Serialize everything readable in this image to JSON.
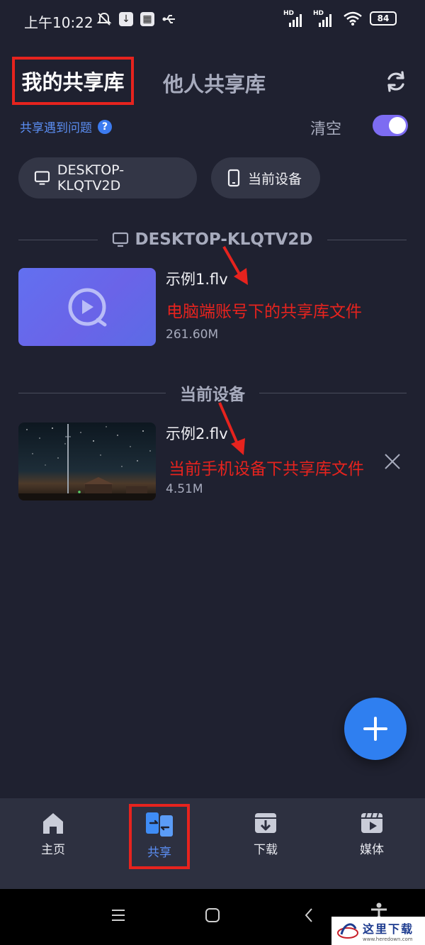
{
  "status_bar": {
    "time": "上午10:22",
    "battery": "84",
    "network_label": "HD"
  },
  "header": {
    "tab_mine": "我的共享库",
    "tab_others": "他人共享库"
  },
  "toolbar": {
    "problem_link": "共享遇到问题",
    "clear_label": "清空",
    "toggle_on": true
  },
  "chips": [
    {
      "label": "DESKTOP-KLQTV2D",
      "icon": "monitor-icon"
    },
    {
      "label": "当前设备",
      "icon": "phone-icon"
    }
  ],
  "sections": [
    {
      "title": "DESKTOP-KLQTV2D",
      "icon": "monitor-icon",
      "files": [
        {
          "name": "示例1.flv",
          "size": "261.60M",
          "annotation": "电脑端账号下的共享库文件"
        }
      ]
    },
    {
      "title": "当前设备",
      "files": [
        {
          "name": "示例2.flv",
          "size": "4.51M",
          "annotation": "当前手机设备下共享库文件"
        }
      ]
    }
  ],
  "bottom_nav": [
    {
      "label": "主页",
      "icon": "home-icon"
    },
    {
      "label": "共享",
      "icon": "share-icon",
      "active": true
    },
    {
      "label": "下载",
      "icon": "download-icon"
    },
    {
      "label": "媒体",
      "icon": "media-icon"
    }
  ],
  "colors": {
    "background": "#1f2130",
    "accent_blue": "#2f7ff0",
    "annotation_red": "#e6231e",
    "toggle_purple": "#7d6cf2"
  },
  "watermark": {
    "text": "这里下载",
    "url": "www.heredown.com"
  }
}
